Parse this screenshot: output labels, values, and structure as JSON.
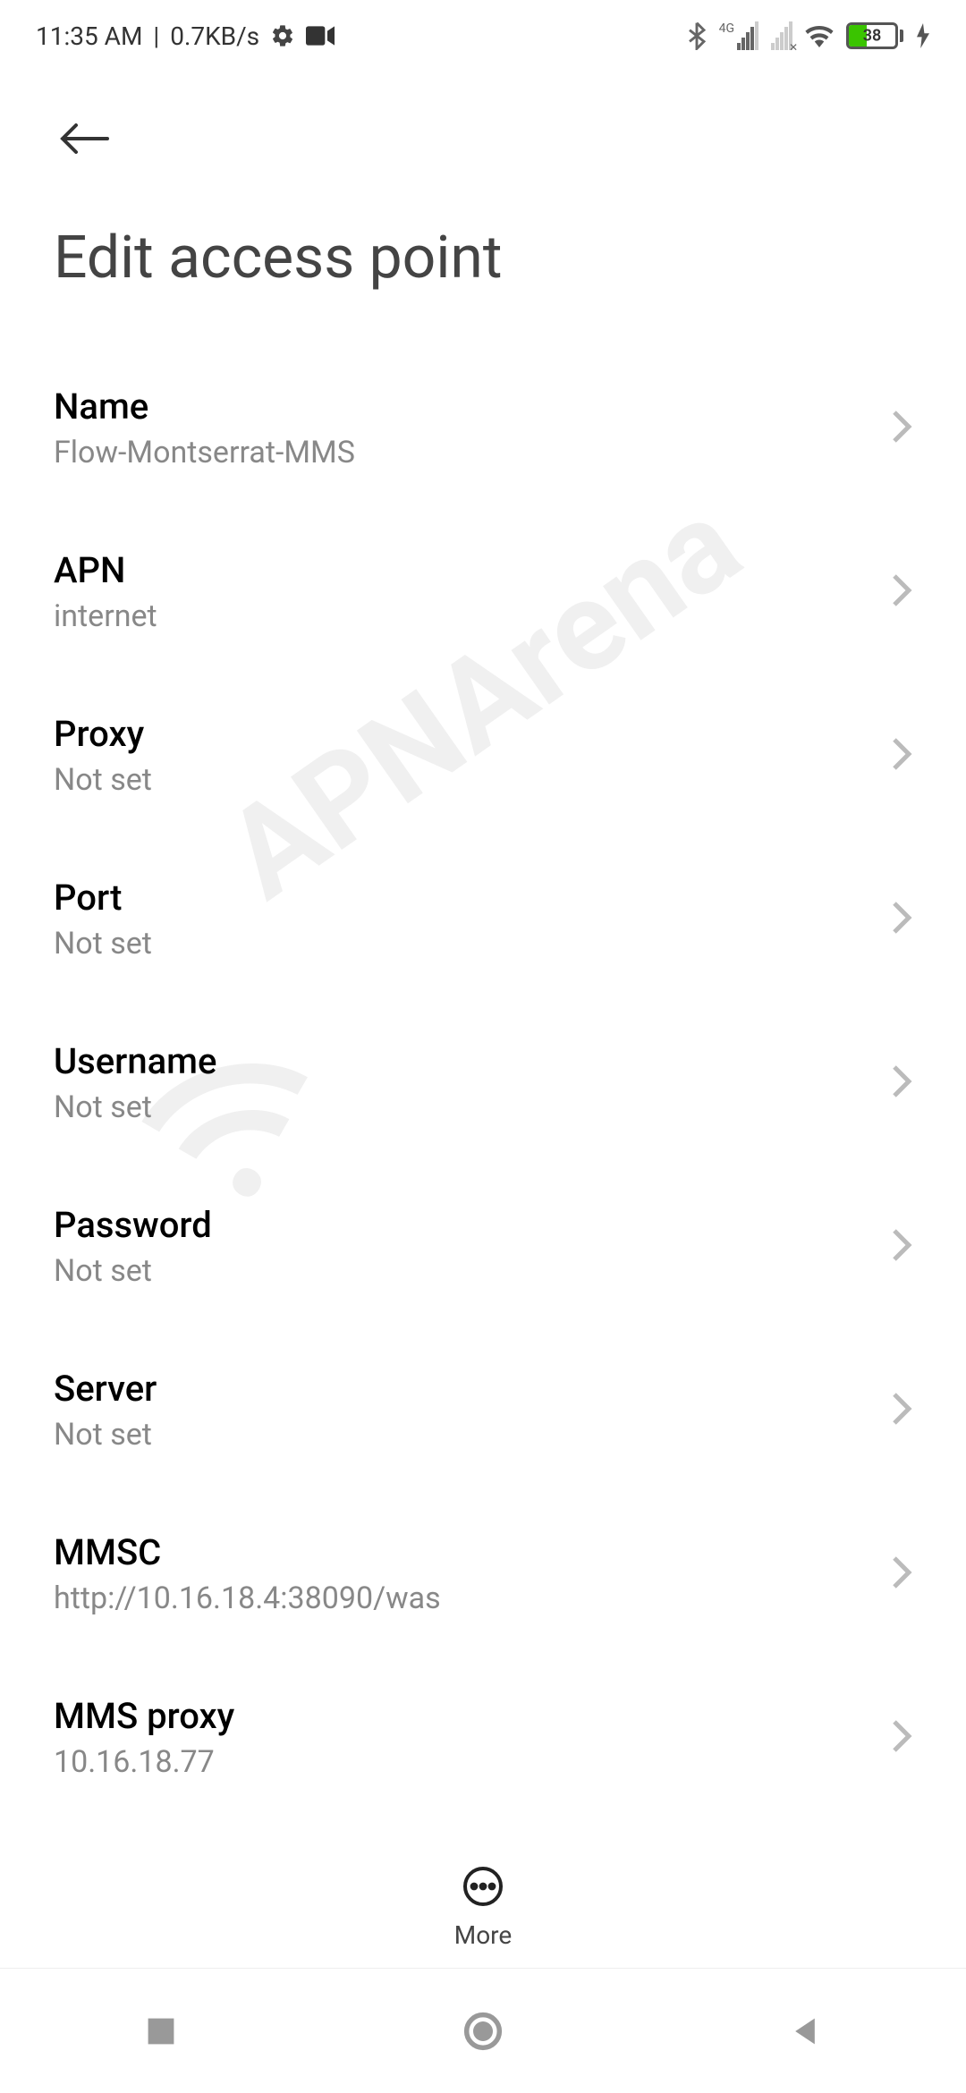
{
  "status": {
    "time": "11:35 AM",
    "speed": "0.7KB/s",
    "network_label": "4G",
    "battery_pct": "38"
  },
  "header": {
    "title": "Edit access point"
  },
  "fields": [
    {
      "label": "Name",
      "value": "Flow-Montserrat-MMS"
    },
    {
      "label": "APN",
      "value": "internet"
    },
    {
      "label": "Proxy",
      "value": "Not set"
    },
    {
      "label": "Port",
      "value": "Not set"
    },
    {
      "label": "Username",
      "value": "Not set"
    },
    {
      "label": "Password",
      "value": "Not set"
    },
    {
      "label": "Server",
      "value": "Not set"
    },
    {
      "label": "MMSC",
      "value": "http://10.16.18.4:38090/was"
    },
    {
      "label": "MMS proxy",
      "value": "10.16.18.77"
    }
  ],
  "bottom": {
    "more_label": "More"
  },
  "watermark": "APNArena"
}
